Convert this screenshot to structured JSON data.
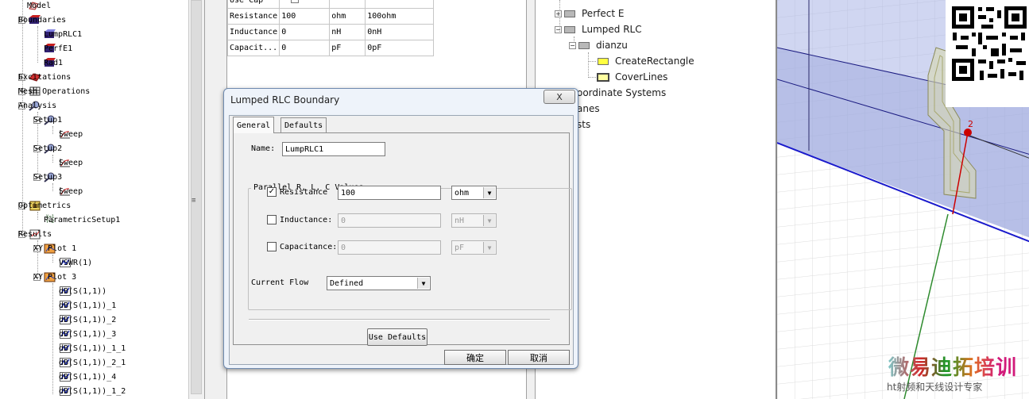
{
  "project_tree": {
    "items": [
      {
        "label": "Model",
        "level": 1
      },
      {
        "label": "Boundaries",
        "level": 1
      },
      {
        "label": "LumpRLC1",
        "level": 2
      },
      {
        "label": "PerfE1",
        "level": 2
      },
      {
        "label": "Rad1",
        "level": 2
      },
      {
        "label": "Excitations",
        "level": 1
      },
      {
        "label": "Mesh Operations",
        "level": 1
      },
      {
        "label": "Analysis",
        "level": 1
      },
      {
        "label": "Setup1",
        "level": 2
      },
      {
        "label": "Sweep",
        "level": 3
      },
      {
        "label": "Setup2",
        "level": 2
      },
      {
        "label": "Sweep",
        "level": 3
      },
      {
        "label": "Setup3",
        "level": 2
      },
      {
        "label": "Sweep",
        "level": 3
      },
      {
        "label": "Optimetrics",
        "level": 1
      },
      {
        "label": "ParametricSetup1",
        "level": 2
      },
      {
        "label": "Results",
        "level": 1
      },
      {
        "label": "XY Plot 1",
        "level": 2
      },
      {
        "label": "VSWR(1)",
        "level": 3
      },
      {
        "label": "XY Plot 3",
        "level": 2
      },
      {
        "label": "dB(S(1,1))",
        "level": 3
      },
      {
        "label": "dB(S(1,1))_1",
        "level": 3
      },
      {
        "label": "dB(S(1,1))_2",
        "level": 3
      },
      {
        "label": "dB(S(1,1))_3",
        "level": 3
      },
      {
        "label": "dB(S(1,1))_1_1",
        "level": 3
      },
      {
        "label": "dB(S(1,1))_2_1",
        "level": 3
      },
      {
        "label": "dB(S(1,1))_4",
        "level": 3
      },
      {
        "label": "dB(S(1,1))_1_2",
        "level": 3
      }
    ]
  },
  "properties": {
    "rows": [
      [
        "Use Cap",
        "",
        "",
        ""
      ],
      [
        "Resistance",
        "100",
        "ohm",
        "100ohm"
      ],
      [
        "Inductance",
        "0",
        "nH",
        "0nH"
      ],
      [
        "Capacit...",
        "0",
        "pF",
        "0pF"
      ]
    ]
  },
  "model_tree": {
    "items": [
      {
        "label": "Perfect E",
        "expander": "+"
      },
      {
        "label": "Lumped RLC",
        "expander": "-"
      },
      {
        "label": "dianzu",
        "expander": "-"
      },
      {
        "label": "CreateRectangle",
        "expander": ""
      },
      {
        "label": "CoverLines",
        "expander": ""
      },
      {
        "label": "oordinate Systems",
        "expander": ""
      },
      {
        "label": "anes",
        "expander": ""
      },
      {
        "label": "sts",
        "expander": ""
      }
    ]
  },
  "dialog": {
    "title": "Lumped RLC Boundary",
    "close_label": "X",
    "tabs": [
      "General",
      "Defaults"
    ],
    "name_label": "Name:",
    "name_value": "LumpRLC1",
    "group_title": "Parallel R, L, C Values",
    "resistance": {
      "label": "Resistance",
      "checked": true,
      "value": "100",
      "unit": "ohm"
    },
    "inductance": {
      "label": "Inductance:",
      "checked": false,
      "value": "0",
      "unit": "nH"
    },
    "capacitance": {
      "label": "Capacitance:",
      "checked": false,
      "value": "0",
      "unit": "pF"
    },
    "current_flow_label": "Current Flow",
    "current_flow_value": "Defined",
    "use_defaults_label": "Use Defaults",
    "ok_label": "确定",
    "cancel_label": "取消"
  },
  "view3d": {
    "marker_label": "2",
    "watermark_top": "微易迪拓培训",
    "watermark_bottom": "ht射频和天线设计专家"
  },
  "colors": {
    "dialog_bg": "#eef3fa",
    "selection_fill": "#aab4e6",
    "port_red": "#cc0000",
    "axis_green": "#2e8b2e",
    "axis_blue": "#1a1acc"
  }
}
